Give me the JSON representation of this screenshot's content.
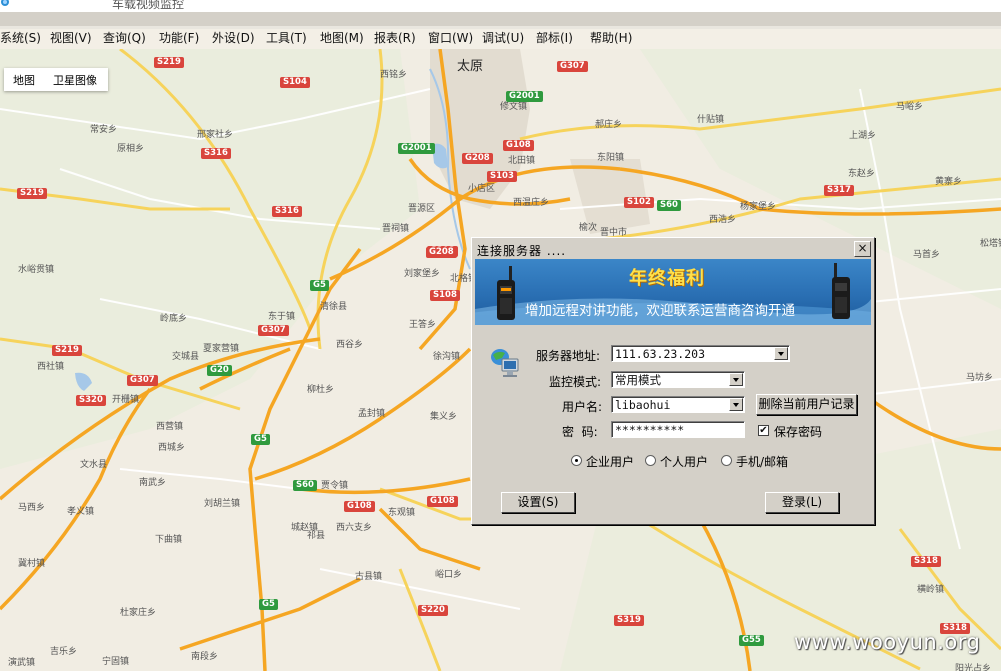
{
  "window": {
    "title": "车载视频监控"
  },
  "menu": [
    {
      "label": "系统(S)"
    },
    {
      "label": "视图(V)"
    },
    {
      "label": "查询(Q)"
    },
    {
      "label": "功能(F)"
    },
    {
      "label": "外设(D)"
    },
    {
      "label": "工具(T)"
    },
    {
      "label": "地图(M)"
    },
    {
      "label": "报表(R)"
    },
    {
      "label": "窗口(W)"
    },
    {
      "label": "调试(U)"
    },
    {
      "label": "部标(I)"
    },
    {
      "label": "帮助(H)"
    }
  ],
  "map": {
    "type_buttons": [
      "地图",
      "卫星图像"
    ],
    "cities": [
      {
        "name": "太原",
        "big": true
      },
      {
        "name": "交城县"
      },
      {
        "name": "文水县"
      },
      {
        "name": "清徐县"
      },
      {
        "name": "晋源区"
      },
      {
        "name": "小店区"
      },
      {
        "name": "晋中市"
      },
      {
        "name": "祁县"
      },
      {
        "name": "榆次"
      }
    ],
    "towns": [
      "西铭乡",
      "马峪乡",
      "常安乡",
      "邢家社乡",
      "原相乡",
      "西社镇",
      "水峪贯镇",
      "岭底乡",
      "东于镇",
      "夏家营镇",
      "开栅镇",
      "西营镇",
      "西城乡",
      "南武乡",
      "马西乡",
      "孝义镇",
      "下曲镇",
      "刘胡兰镇",
      "贾令镇",
      "城赵镇",
      "东观镇",
      "西六支乡",
      "古县镇",
      "杜家庄乡",
      "宁固镇",
      "南段乡",
      "吉乐乡",
      "冀村镇",
      "演武镇",
      "峪口乡",
      "北格镇",
      "刘家堡乡",
      "王答乡",
      "西谷乡",
      "徐沟镇",
      "柳杜乡",
      "孟封镇",
      "集义乡",
      "马首乡",
      "修文镇",
      "西浩乡",
      "上湖乡",
      "东赵乡",
      "黄寨乡",
      "什贴镇",
      "马坊乡",
      "横岭镇",
      "阳光占乡",
      "晋祠镇",
      "西温庄乡",
      "郝庄乡",
      "东阳镇",
      "杨家堡乡",
      "松塔镇",
      "北田镇"
    ],
    "roads": [
      "S219",
      "S104",
      "S316",
      "S219",
      "S316",
      "G2001",
      "G208",
      "G108",
      "S103",
      "S102",
      "S60",
      "S317",
      "G307",
      "G5",
      "G20",
      "G307",
      "S320",
      "G5",
      "S60",
      "G108",
      "G108",
      "S219",
      "S108",
      "S220",
      "G5",
      "S319",
      "G55",
      "S318",
      "S318",
      "G307",
      "G208",
      "G2001",
      "G208"
    ],
    "watermark": "www.wooyun.org"
  },
  "dialog": {
    "title": "连接服务器 ....",
    "close_label": "×",
    "banner": {
      "headline": "年终福利",
      "subtext": "增加远程对讲功能，欢迎联系运营商咨询开通"
    },
    "server_label": "服务器地址:",
    "server_value": "111.63.23.203",
    "mode_label": "监控模式:",
    "mode_value": "常用模式",
    "user_label": "用户名:",
    "user_value": "libaohui",
    "delete_record_button": "删除当前用户记录",
    "password_label": "密  码:",
    "password_value": "**********",
    "save_password_label": "保存密码",
    "save_password_checked": true,
    "radio_options": [
      "企业用户",
      "个人用户",
      "手机/邮箱"
    ],
    "radio_selected": "企业用户",
    "settings_button": "设置(S)",
    "login_button": "登录(L)"
  }
}
